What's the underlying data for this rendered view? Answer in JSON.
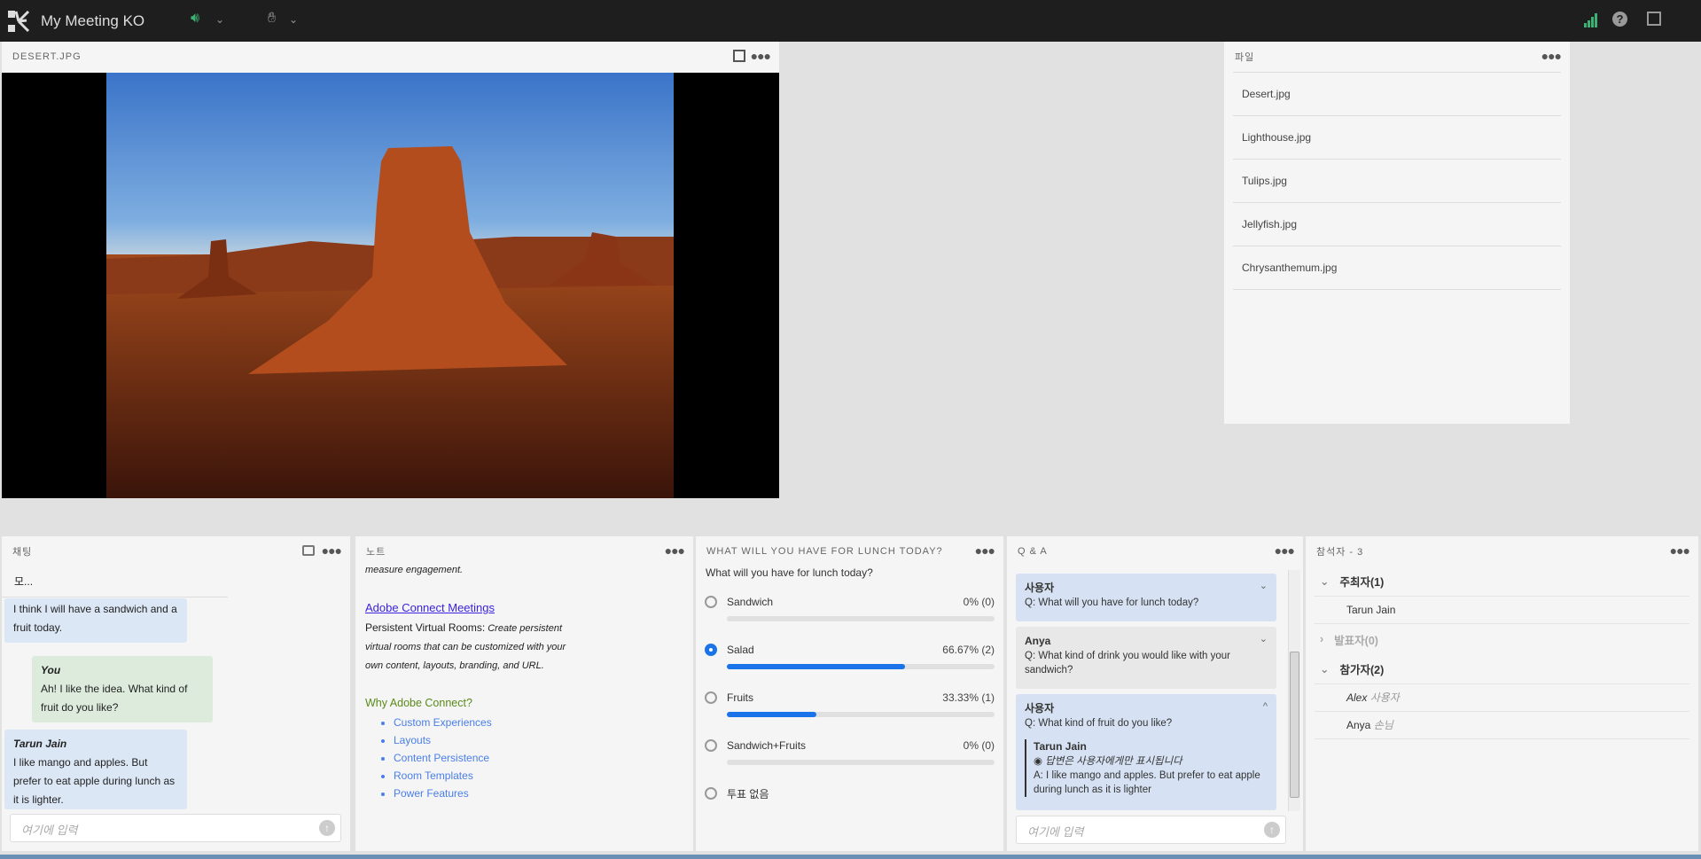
{
  "topbar": {
    "title": "My Meeting KO",
    "icons": [
      "adobe-connect-logo",
      "speaker-icon",
      "raise-hand-icon",
      "signal-icon",
      "help-icon",
      "fullscreen-icon"
    ],
    "accent": "#3bb273"
  },
  "share_pod": {
    "title": "DESERT.JPG"
  },
  "files_pod": {
    "title": "파일",
    "files": [
      "Desert.jpg",
      "Lighthouse.jpg",
      "Tulips.jpg",
      "Jellyfish.jpg",
      "Chrysanthemum.jpg"
    ]
  },
  "chat": {
    "title": "채팅",
    "tab": "모...",
    "truncated_sender": "Tarun Jain",
    "messages": [
      {
        "sender": "",
        "text": "I think I will have a sandwich and a fruit today."
      },
      {
        "sender": "You",
        "text": "Ah! I like the idea. What kind of fruit do you like?"
      },
      {
        "sender": "Tarun Jain",
        "text": "I like mango and apples. But prefer to eat apple during lunch as it is lighter."
      }
    ],
    "placeholder": "여기에 입력"
  },
  "notes": {
    "title": "노트",
    "line1": "measure engagement.",
    "link": "Adobe Connect Meetings",
    "bold": "Persistent Virtual Rooms:",
    "italic": "Create persistent virtual rooms that can be customized with your own content, layouts, branding, and URL.",
    "heading": "Why Adobe Connect?",
    "bullets": [
      "Custom Experiences",
      "Layouts",
      "Content Persistence",
      "Room Templates",
      "Power Features"
    ]
  },
  "poll": {
    "title": "WHAT WILL YOU HAVE FOR LUNCH TODAY?",
    "question": "What will you have for lunch today?",
    "options": [
      {
        "label": "Sandwich",
        "result": "0% (0)",
        "percent": 0,
        "selected": false
      },
      {
        "label": "Salad",
        "result": "66.67% (2)",
        "percent": 66.67,
        "selected": true
      },
      {
        "label": "Fruits",
        "result": "33.33% (1)",
        "percent": 33.33,
        "selected": false
      },
      {
        "label": "Sandwich+Fruits",
        "result": "0% (0)",
        "percent": 0,
        "selected": false
      }
    ],
    "no_vote": "투표 없음"
  },
  "qa": {
    "title": "Q & A",
    "items": [
      {
        "user": "사용자",
        "q": "Q: What will you have for lunch today?"
      },
      {
        "user": "Anya",
        "q": "Q: What kind of drink you would like with your sandwich?"
      },
      {
        "user": "사용자",
        "q": "Q: What kind of fruit do you like?",
        "answer_by": "Tarun Jain",
        "visibility": "답변은 사용자에게만 표시됩니다",
        "answer": "A: I like mango and apples. But prefer to eat apple during lunch as it is lighter"
      }
    ],
    "placeholder": "여기에 입력"
  },
  "attendees": {
    "title": "참석자 - 3",
    "groups": [
      {
        "label": "주최자(1)",
        "members": [
          {
            "name": "Tarun Jain",
            "role": ""
          }
        ]
      },
      {
        "label": "발표자(0)",
        "members": []
      },
      {
        "label": "참가자(2)",
        "members": [
          {
            "name": "Alex",
            "role": "사용자"
          },
          {
            "name": "Anya",
            "role": "손님"
          }
        ]
      }
    ]
  }
}
